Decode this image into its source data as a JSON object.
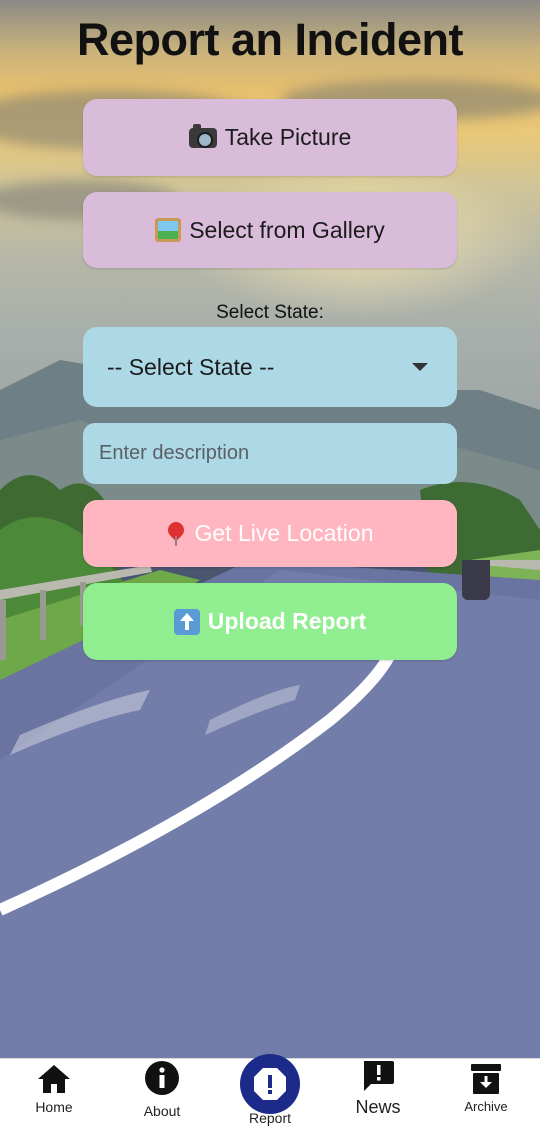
{
  "page": {
    "title": "Report an Incident"
  },
  "buttons": {
    "take_picture": {
      "icon": "camera-icon",
      "label": "Take Picture"
    },
    "select_gallery": {
      "icon": "framed-picture-icon",
      "label": "Select from Gallery"
    },
    "live_location": {
      "icon": "pin-icon",
      "label": "Get Live Location"
    },
    "upload_report": {
      "icon": "up-arrow-icon",
      "label": "Upload Report"
    }
  },
  "state": {
    "label": "Select State:",
    "selected": "-- Select State --"
  },
  "description": {
    "placeholder": "Enter description",
    "value": ""
  },
  "colors": {
    "gallery_button": "#d8bcd9",
    "select_bg": "#add8e6",
    "location_button": "#ffb6c1",
    "upload_button": "#90ee90",
    "report_nav_accent": "#1c2a8a"
  },
  "nav": {
    "items": [
      {
        "icon": "home-icon",
        "label": "Home"
      },
      {
        "icon": "info-icon",
        "label": "About"
      },
      {
        "icon": "alert-octagon-icon",
        "label": "Report"
      },
      {
        "icon": "news-alert-icon",
        "label": "News"
      },
      {
        "icon": "archive-icon",
        "label": "Archive"
      }
    ]
  }
}
